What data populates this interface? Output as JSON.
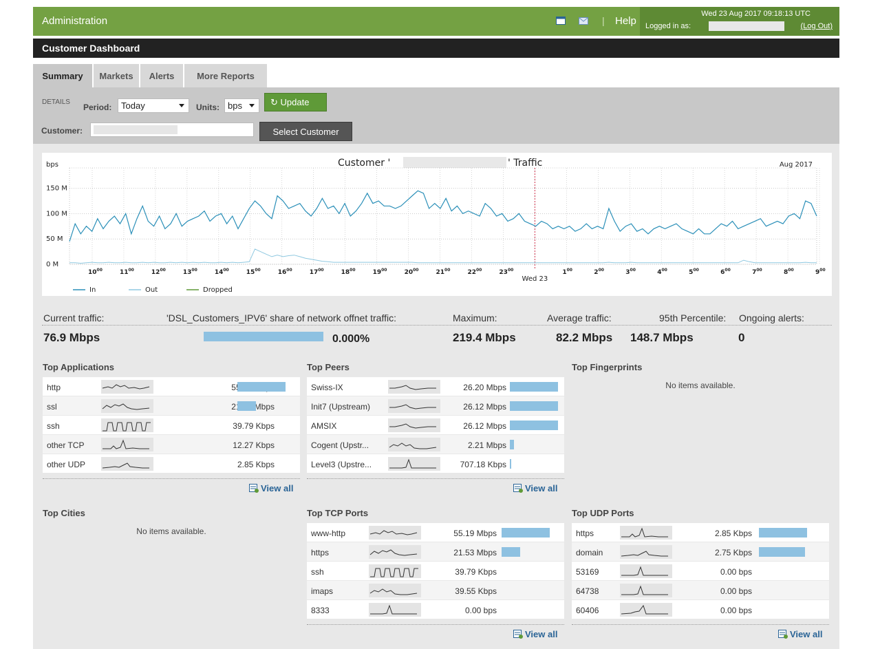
{
  "header": {
    "title": "Administration",
    "help": "Help",
    "datetime": "Wed 23 Aug 2017 09:18:13 UTC",
    "logged_in_as": "Logged in as:",
    "logout": "(Log Out)",
    "icons": [
      "window-icon",
      "mail-icon"
    ]
  },
  "page_title": "Customer Dashboard",
  "tabs": [
    {
      "label": "Summary",
      "active": true
    },
    {
      "label": "Markets",
      "active": false
    },
    {
      "label": "Alerts",
      "active": false
    },
    {
      "label": "More Reports",
      "active": false
    }
  ],
  "controls": {
    "details_label": "DETAILS",
    "period_label": "Period:",
    "period_value": "Today",
    "units_label": "Units:",
    "units_value": "bps",
    "update_label": "Update",
    "customer_label": "Customer:",
    "select_customer_label": "Select Customer"
  },
  "chart_data": {
    "type": "line",
    "title_prefix": "Customer '",
    "title_suffix": "' Traffic",
    "ylabel": "bps",
    "period_label": "Aug 2017",
    "ylim": [
      0,
      190
    ],
    "y_ticks": [
      "150 M",
      "100 M",
      "50 M",
      "0 M"
    ],
    "y_tick_values": [
      150,
      100,
      50,
      0
    ],
    "x_ticks": [
      "10",
      "11",
      "12",
      "13",
      "14",
      "15",
      "16",
      "17",
      "18",
      "19",
      "20",
      "21",
      "22",
      "23",
      "Wed 23",
      "1",
      "2",
      "3",
      "4",
      "5",
      "6",
      "7",
      "8",
      "9"
    ],
    "tick_suffix": "00",
    "legend": [
      "In",
      "Out",
      "Dropped"
    ],
    "legend_colors": [
      "#2a8fb8",
      "#8ec8e0",
      "#5f9a38"
    ],
    "series": [
      {
        "name": "In",
        "values": [
          45,
          80,
          60,
          75,
          65,
          90,
          70,
          85,
          95,
          80,
          100,
          60,
          90,
          115,
          85,
          75,
          95,
          70,
          80,
          100,
          75,
          85,
          90,
          95,
          105,
          85,
          95,
          100,
          80,
          95,
          70,
          90,
          110,
          125,
          115,
          100,
          90,
          135,
          125,
          110,
          115,
          120,
          105,
          95,
          110,
          130,
          110,
          115,
          100,
          120,
          95,
          105,
          120,
          140,
          120,
          125,
          115,
          115,
          110,
          115,
          125,
          135,
          145,
          140,
          110,
          120,
          110,
          130,
          105,
          115,
          100,
          105,
          100,
          95,
          120,
          110,
          95,
          100,
          85,
          90,
          100,
          85,
          80,
          75,
          85,
          80,
          70,
          75,
          70,
          75,
          65,
          70,
          80,
          70,
          75,
          70,
          110,
          85,
          65,
          75,
          80,
          65,
          70,
          60,
          70,
          75,
          70,
          75,
          80,
          70,
          65,
          60,
          70,
          60,
          60,
          70,
          80,
          75,
          85,
          70,
          75,
          80,
          85,
          90,
          75,
          80,
          85,
          80,
          95,
          100,
          90,
          125,
          120,
          95
        ]
      },
      {
        "name": "Out",
        "values": [
          3,
          3,
          2,
          3,
          4,
          3,
          3,
          4,
          3,
          3,
          4,
          3,
          3,
          4,
          3,
          4,
          3,
          3,
          4,
          3,
          4,
          3,
          4,
          3,
          4,
          3,
          3,
          4,
          3,
          4,
          3,
          4,
          5,
          30,
          25,
          20,
          15,
          18,
          15,
          17,
          18,
          15,
          12,
          10,
          8,
          6,
          5,
          4,
          4,
          4,
          4,
          4,
          4,
          4,
          4,
          4,
          4,
          4,
          4,
          4,
          4,
          4,
          3,
          3,
          3,
          3,
          3,
          3,
          3,
          3,
          3,
          3,
          3,
          3,
          3,
          3,
          3,
          3,
          3,
          3,
          3,
          3,
          3,
          3,
          3,
          3,
          3,
          3,
          3,
          3,
          3,
          3,
          3,
          3,
          3,
          3,
          4,
          3,
          3,
          3,
          4,
          3,
          3,
          3,
          3,
          3,
          3,
          3,
          3,
          3,
          3,
          3,
          3,
          3,
          3,
          3,
          3,
          3,
          3,
          3,
          8,
          5,
          3,
          3,
          3,
          3,
          3,
          3,
          3,
          3,
          3,
          4,
          3,
          3
        ]
      },
      {
        "name": "Dropped",
        "values": []
      }
    ]
  },
  "stats": {
    "current_label": "Current traffic:",
    "current_value": "76.9 Mbps",
    "share_label": "'DSL_Customers_IPV6' share of network offnet traffic:",
    "share_value": "0.000%",
    "max_label": "Maximum:",
    "max_value": "219.4 Mbps",
    "avg_label": "Average traffic:",
    "avg_value": "82.2 Mbps",
    "p95_label": "95th Percentile:",
    "p95_value": "148.7 Mbps",
    "alerts_label": "Ongoing alerts:",
    "alerts_value": "0"
  },
  "sections": {
    "top_applications": {
      "title": "Top Applications",
      "rows": [
        {
          "name": "http",
          "value": "55.19 Mbps",
          "fraction": 1.0
        },
        {
          "name": "ssl",
          "value": "21.64 Mbps",
          "fraction": 0.39
        },
        {
          "name": "ssh",
          "value": "39.79 Kbps",
          "fraction": 0
        },
        {
          "name": "other TCP",
          "value": "12.27 Kbps",
          "fraction": 0
        },
        {
          "name": "other UDP",
          "value": "2.85 Kbps",
          "fraction": 0
        }
      ],
      "view_all": "View all"
    },
    "top_peers": {
      "title": "Top Peers",
      "rows": [
        {
          "name": "Swiss-IX",
          "value": "26.20 Mbps",
          "fraction": 1.0
        },
        {
          "name": "Init7 (Upstream)",
          "value": "26.12 Mbps",
          "fraction": 1.0
        },
        {
          "name": "AMSIX",
          "value": "26.12 Mbps",
          "fraction": 1.0
        },
        {
          "name": "Cogent (Upstr...",
          "value": "2.21 Mbps",
          "fraction": 0.08
        },
        {
          "name": "Level3 (Upstre...",
          "value": "707.18 Kbps",
          "fraction": 0.03
        }
      ],
      "view_all": "View all"
    },
    "top_fingerprints": {
      "title": "Top Fingerprints",
      "empty": "No items available."
    },
    "top_cities": {
      "title": "Top Cities",
      "empty": "No items available."
    },
    "top_tcp_ports": {
      "title": "Top TCP Ports",
      "rows": [
        {
          "name": "www-http",
          "value": "55.19 Mbps",
          "fraction": 1.0
        },
        {
          "name": "https",
          "value": "21.53 Mbps",
          "fraction": 0.39
        },
        {
          "name": "ssh",
          "value": "39.79 Kbps",
          "fraction": 0
        },
        {
          "name": "imaps",
          "value": "39.55 Kbps",
          "fraction": 0
        },
        {
          "name": "8333",
          "value": "0.00 bps",
          "fraction": 0
        }
      ],
      "view_all": "View all"
    },
    "top_udp_ports": {
      "title": "Top UDP Ports",
      "rows": [
        {
          "name": "https",
          "value": "2.85 Kbps",
          "fraction": 1.0
        },
        {
          "name": "domain",
          "value": "2.75 Kbps",
          "fraction": 0.96
        },
        {
          "name": "53169",
          "value": "0.00 bps",
          "fraction": 0
        },
        {
          "name": "64738",
          "value": "0.00 bps",
          "fraction": 0
        },
        {
          "name": "60406",
          "value": "0.00 bps",
          "fraction": 0
        }
      ],
      "view_all": "View all"
    }
  }
}
